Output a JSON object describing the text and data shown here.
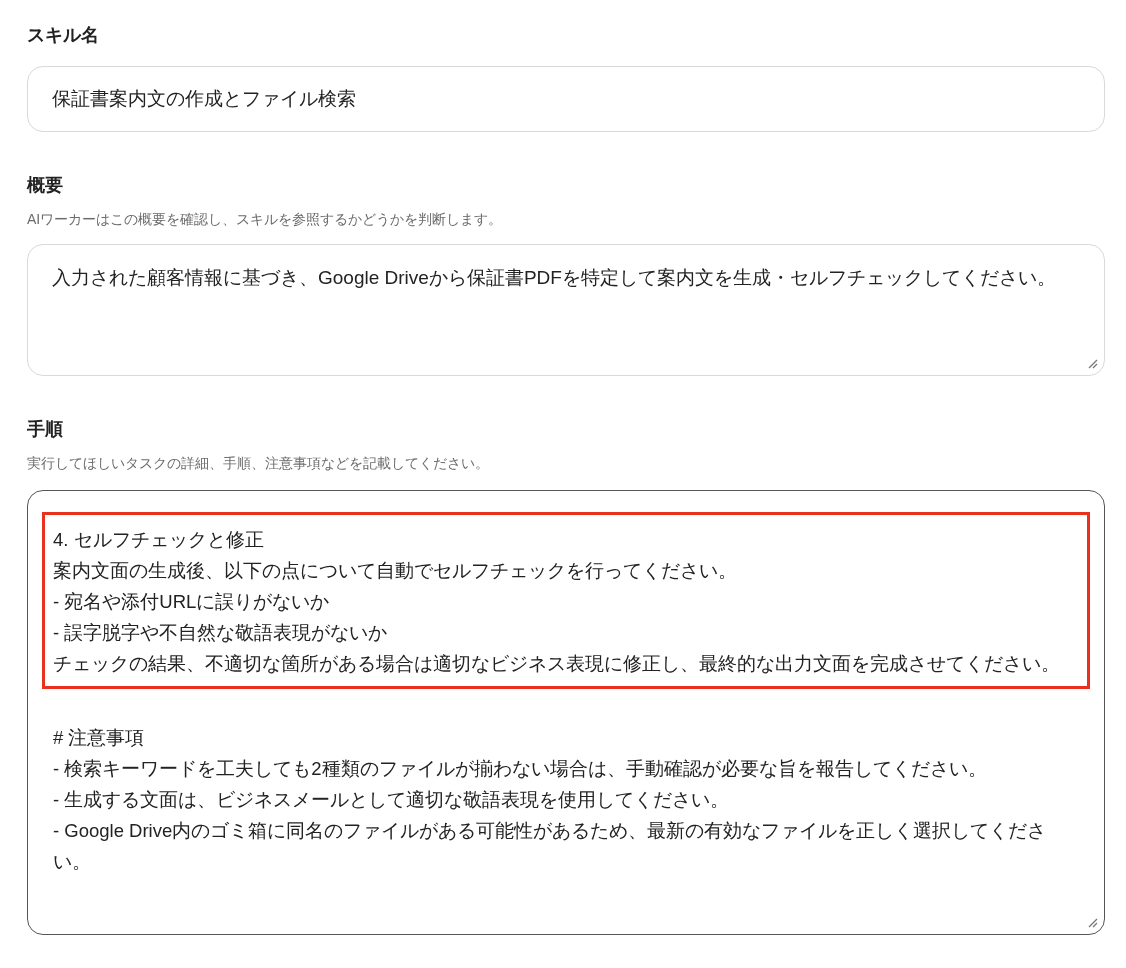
{
  "skill_name": {
    "label": "スキル名",
    "value": "保証書案内文の作成とファイル検索"
  },
  "summary": {
    "label": "概要",
    "hint": "AIワーカーはこの概要を確認し、スキルを参照するかどうかを判断します。",
    "value": "入力された顧客情報に基づき、Google Driveから保証書PDFを特定して案内文を生成・セルフチェックしてください。"
  },
  "instructions": {
    "label": "手順",
    "hint": "実行してほしいタスクの詳細、手順、注意事項などを記載してください。",
    "highlighted_lines": [
      "4. セルフチェックと修正",
      "案内文面の生成後、以下の点について自動でセルフチェックを行ってください。",
      "- 宛名や添付URLに誤りがないか",
      "- 誤字脱字や不自然な敬語表現がないか",
      "チェックの結果、不適切な箇所がある場合は適切なビジネス表現に修正し、最終的な出力文面を完成させてください。"
    ],
    "lines": [
      "# 注意事項",
      "- 検索キーワードを工夫しても2種類のファイルが揃わない場合は、手動確認が必要な旨を報告してください。",
      "- 生成する文面は、ビジネスメールとして適切な敬語表現を使用してください。",
      "- Google Drive内のゴミ箱に同名のファイルがある可能性があるため、最新の有効なファイルを正しく選択してください。"
    ]
  }
}
